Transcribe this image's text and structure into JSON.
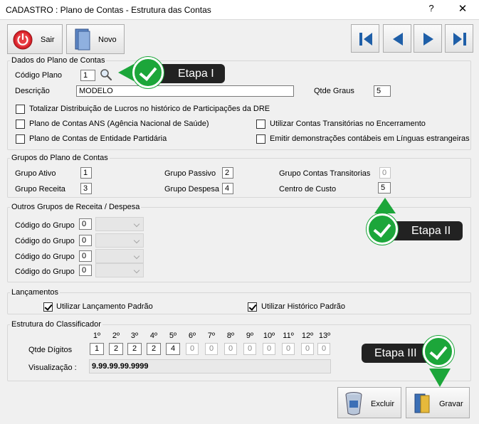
{
  "window": {
    "title": "CADASTRO : Plano de Contas - Estrutura das Contas",
    "help": "?",
    "close": "✕"
  },
  "toolbar": {
    "sair": "Sair",
    "novo": "Novo",
    "excluir": "Excluir",
    "gravar": "Gravar"
  },
  "dados": {
    "legend": "Dados do Plano de Contas",
    "codigo_label": "Código Plano",
    "codigo_value": "1",
    "descricao_label": "Descrição",
    "descricao_value": "MODELO",
    "graus_label": "Qtde Graus",
    "graus_value": "5",
    "checks": [
      {
        "label": "Totalizar Distribuição de Lucros no histórico de Participações da DRE",
        "checked": false
      },
      {
        "label": "Plano de Contas ANS (Agência Nacional de Saúde)",
        "checked": false
      },
      {
        "label": "Utilizar Contas Transitórias no Encerramento",
        "checked": false
      },
      {
        "label": "Plano de Contas de Entidade Partidária",
        "checked": false
      },
      {
        "label": "Emitir demonstrações contábeis em Línguas estrangeiras",
        "checked": false
      }
    ]
  },
  "grupos": {
    "legend": "Grupos do Plano de Contas",
    "ativo_label": "Grupo Ativo",
    "ativo": "1",
    "passivo_label": "Grupo Passivo",
    "passivo": "2",
    "transit_label": "Grupo Contas Transitorias",
    "transit": "0",
    "receita_label": "Grupo Receita",
    "receita": "3",
    "despesa_label": "Grupo Despesa",
    "despesa": "4",
    "custo_label": "Centro de Custo",
    "custo": "5"
  },
  "outros": {
    "legend": "Outros Grupos de Receita / Despesa",
    "rows": [
      {
        "label": "Código do Grupo",
        "value": "0"
      },
      {
        "label": "Código do Grupo",
        "value": "0"
      },
      {
        "label": "Código do Grupo",
        "value": "0"
      },
      {
        "label": "Código do Grupo",
        "value": "0"
      }
    ]
  },
  "lancamentos": {
    "legend": "Lançamentos",
    "padrao": "Utilizar Lançamento Padrão",
    "historico": "Utilizar Histórico Padrão"
  },
  "estrutura": {
    "legend": "Estrutura do Classificador",
    "ordinals": [
      "1º",
      "2º",
      "3º",
      "4º",
      "5º",
      "6º",
      "7º",
      "8º",
      "9º",
      "10º",
      "11º",
      "12º",
      "13º"
    ],
    "digits_label": "Qtde Dígitos",
    "digits": [
      "1",
      "2",
      "2",
      "2",
      "4",
      "0",
      "0",
      "0",
      "0",
      "0",
      "0",
      "0",
      "0"
    ],
    "visual_label": "Visualização :",
    "visual_value": "9.99.99.99.9999"
  },
  "callouts": {
    "e1": "Etapa I",
    "e2": "Etapa II",
    "e3": "Etapa III"
  },
  "colors": {
    "accent_green": "#1ca63a",
    "callout_bg": "#222222"
  }
}
